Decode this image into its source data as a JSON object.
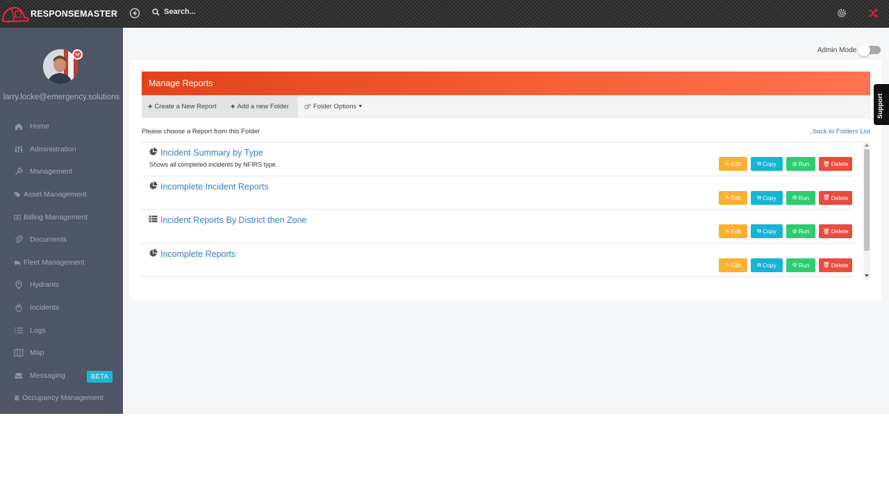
{
  "topbar": {
    "brand": "RESPONSEMASTER",
    "search_label": "Search..."
  },
  "sidebar": {
    "user_email": "larry.locke@emergency.solutions",
    "items": [
      {
        "label": "Home",
        "icon": "home-icon"
      },
      {
        "label": "Administration",
        "icon": "sliders-icon"
      },
      {
        "label": "Management",
        "icon": "wrench-icon"
      },
      {
        "label": "Asset Management",
        "icon": "tag-icon"
      },
      {
        "label": "Billing Management",
        "icon": "money-icon"
      },
      {
        "label": "Documents",
        "icon": "paperclip-icon"
      },
      {
        "label": "Fleet Management",
        "icon": "truck-icon"
      },
      {
        "label": "Hydrants",
        "icon": "map-pin-icon"
      },
      {
        "label": "Incidents",
        "icon": "fire-icon"
      },
      {
        "label": "Logs",
        "icon": "list-icon"
      },
      {
        "label": "Map",
        "icon": "map-icon"
      },
      {
        "label": "Messaging",
        "icon": "inbox-icon",
        "badge": "BETA"
      },
      {
        "label": "Occupancy Management",
        "icon": "building-icon"
      }
    ]
  },
  "admin_mode": {
    "label": "Admin Mode",
    "enabled": false
  },
  "panel": {
    "title": "Manage Reports",
    "toolbar": {
      "create_label": "Create a New Report",
      "add_folder_label": "Add a new Folder",
      "folder_options_label": "Folder Options"
    },
    "choose_text": "Please choose a Report from this Folder",
    "back_link": "..back to Folders List",
    "reports": [
      {
        "title": "Incident Summary by Type",
        "description": "Shows all completed incidents by NFIRS type.",
        "icon": "pie-chart-icon"
      },
      {
        "title": "Incomplete Incident Reports",
        "description": "",
        "icon": "pie-chart-icon"
      },
      {
        "title": "Incident Reports By District then Zone",
        "description": "",
        "icon": "table-icon"
      },
      {
        "title": "Incomplete Reports",
        "description": "",
        "icon": "pie-chart-icon"
      }
    ],
    "actions": {
      "edit": "Edit",
      "copy": "Copy",
      "run": "Run",
      "delete": "Delete"
    }
  },
  "support_tab": "Support",
  "colors": {
    "header_gradient_start": "#e2421b",
    "header_gradient_end": "#ff7450",
    "sidebar_bg": "#4e5566",
    "edit": "#fbb032",
    "copy": "#17b4d4",
    "run": "#2ecc71",
    "delete": "#e74c3c",
    "link": "#3a7dc0"
  }
}
